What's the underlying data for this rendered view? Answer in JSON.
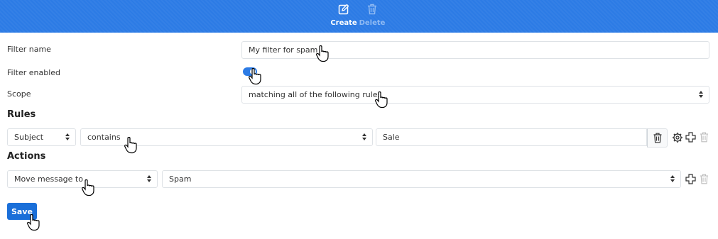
{
  "toolbar": {
    "create_label": "Create",
    "delete_label": "Delete"
  },
  "form": {
    "filter_name_label": "Filter name",
    "filter_name_value": "My filter for spam",
    "filter_enabled_label": "Filter enabled",
    "filter_enabled": true,
    "scope_label": "Scope",
    "scope_value": "matching all of the following rules"
  },
  "rules": {
    "heading": "Rules",
    "items": [
      {
        "field": "Subject",
        "operator": "contains",
        "value": "Sale"
      }
    ]
  },
  "actions": {
    "heading": "Actions",
    "items": [
      {
        "action": "Move message to",
        "target": "Spam"
      }
    ]
  },
  "save_label": "Save",
  "colors": {
    "toolbar_bg": "#2c7be5",
    "primary_button": "#1a6fd9",
    "disabled_icon": "#8fbaf3"
  }
}
